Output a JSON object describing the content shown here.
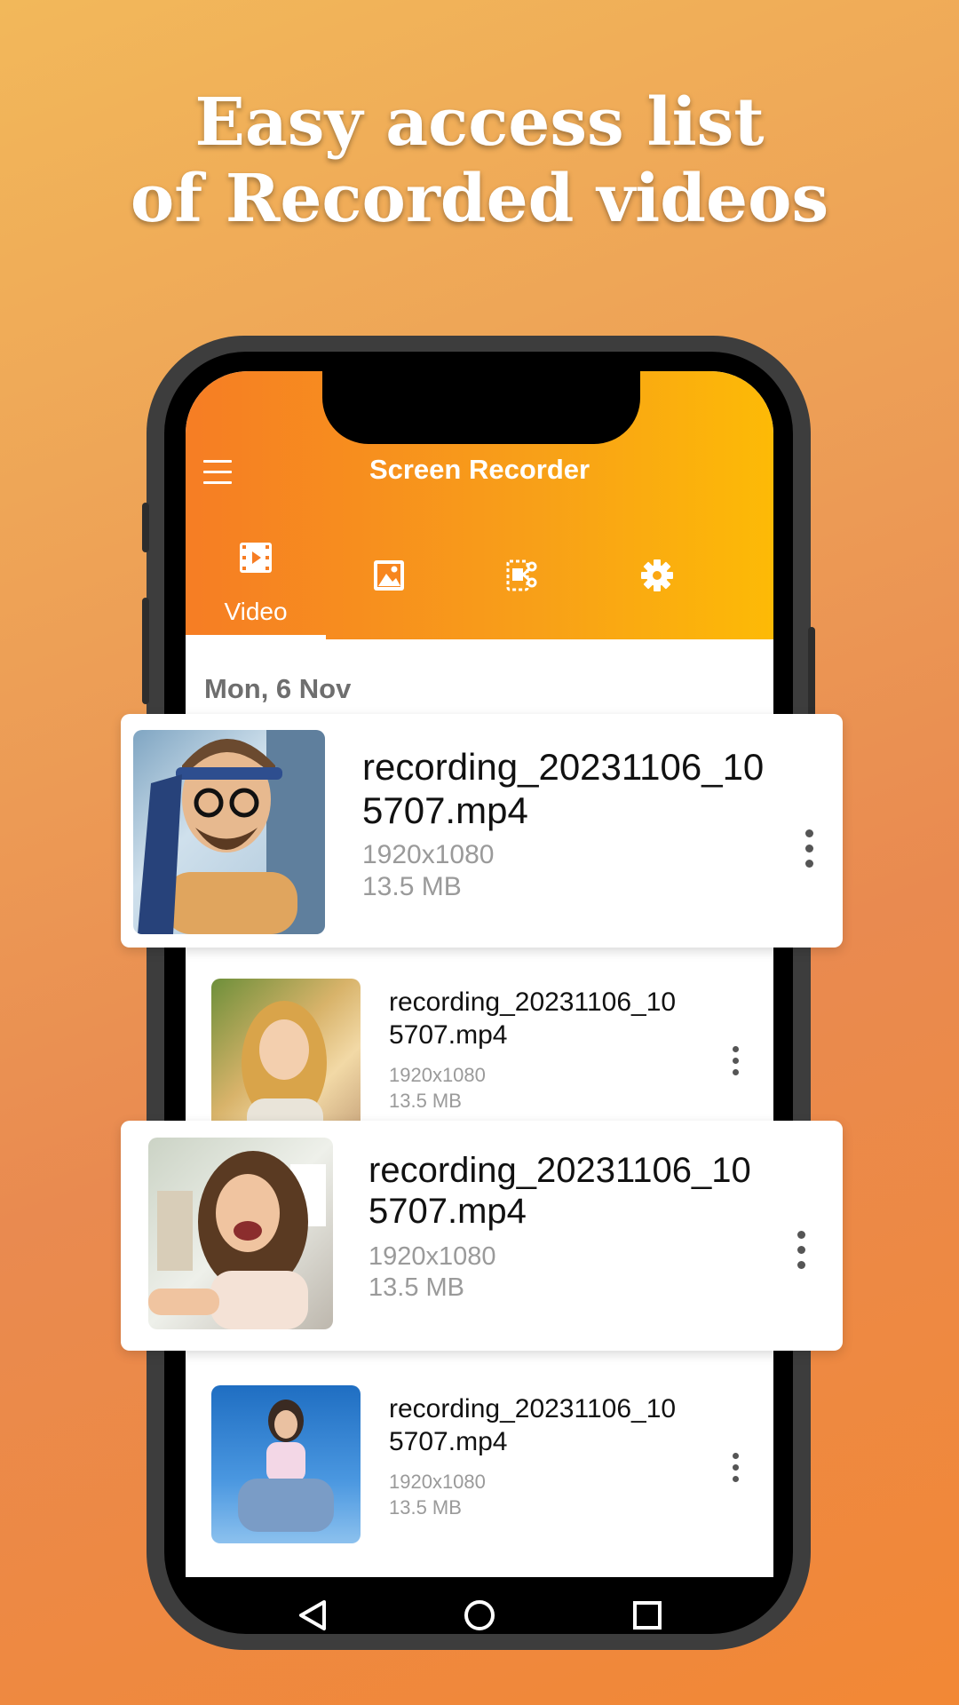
{
  "headline": {
    "line1": "Easy access list",
    "line2": "of Recorded videos"
  },
  "app": {
    "title": "Screen Recorder"
  },
  "tabs": [
    {
      "label": "Video",
      "icon": "film-icon",
      "active": true
    },
    {
      "label": "",
      "icon": "image-icon",
      "active": false
    },
    {
      "label": "",
      "icon": "video-edit-scissors-icon",
      "active": false
    },
    {
      "label": "",
      "icon": "gear-icon",
      "active": false
    }
  ],
  "date_header": "Mon, 6 Nov",
  "recordings": [
    {
      "name_line1": "recording_20231106_10",
      "name_line2": "5707.mp4",
      "resolution": "1920x1080",
      "size": "13.5 MB"
    },
    {
      "name_line1": "recording_20231106_10",
      "name_line2": "5707.mp4",
      "resolution": "1920x1080",
      "size": "13.5 MB"
    },
    {
      "name_line1": "recording_20231106_10",
      "name_line2": "5707.mp4",
      "resolution": "1920x1080",
      "size": "13.5 MB"
    },
    {
      "name_line1": "recording_20231106_10",
      "name_line2": "5707.mp4",
      "resolution": "1920x1080",
      "size": "13.5 MB"
    }
  ],
  "navbar": {
    "back": "back-triangle-icon",
    "home": "home-circle-icon",
    "recents": "recents-square-icon"
  },
  "colors": {
    "accent_start": "#F67D24",
    "accent_end": "#FDBA06",
    "text": "#111111",
    "meta": "#9A9A9A"
  }
}
